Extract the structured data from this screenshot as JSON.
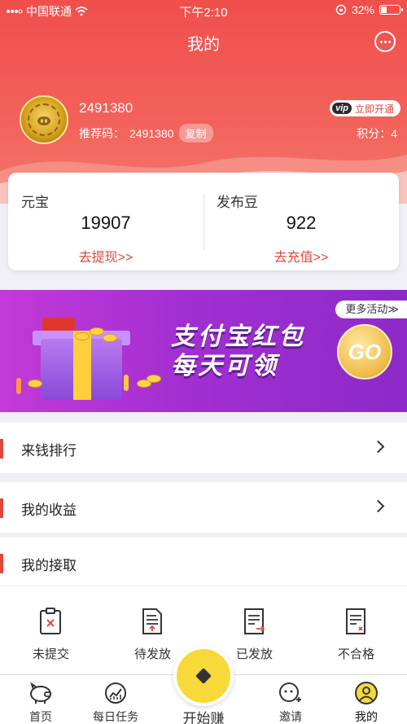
{
  "status_bar": {
    "carrier": "中国联通",
    "time": "下午2:10",
    "battery": "32%",
    "battery_level": 0.32
  },
  "header": {
    "title": "我的"
  },
  "profile": {
    "username": "2491380",
    "referral_label": "推荐码：",
    "referral_code": "2491380",
    "copy_label": "复制",
    "vip_badge": "vip",
    "vip_action": "立即开通",
    "points_label": "积分：",
    "points_value": "4"
  },
  "balances": [
    {
      "label": "元宝",
      "value": "19907",
      "action": "去提现>>"
    },
    {
      "label": "发布豆",
      "value": "922",
      "action": "去充值>>"
    }
  ],
  "banner": {
    "more_label": "更多活动≫",
    "line1": "支付宝红包",
    "line2": "每天可领",
    "go_label": "GO"
  },
  "menu": [
    {
      "label": "来钱排行"
    },
    {
      "label": "我的收益"
    },
    {
      "label": "我的接取"
    }
  ],
  "task_status": [
    {
      "label": "未提交",
      "icon": "clipboard-x-icon"
    },
    {
      "label": "待发放",
      "icon": "document-upload-icon"
    },
    {
      "label": "已发放",
      "icon": "document-sent-icon"
    },
    {
      "label": "不合格",
      "icon": "document-rejected-icon"
    }
  ],
  "tabbar": {
    "items": [
      {
        "label": "首页",
        "icon": "pig-icon"
      },
      {
        "label": "每日任务",
        "icon": "chart-icon"
      },
      {
        "label": "开始赚",
        "icon": "star-icon"
      },
      {
        "label": "邀请",
        "icon": "invite-icon"
      },
      {
        "label": "我的",
        "icon": "profile-icon"
      }
    ]
  },
  "colors": {
    "accent": "#e2463e",
    "header_top": "#f04f4c",
    "banner": "#a22fd1",
    "center_button": "#f7d93a"
  }
}
